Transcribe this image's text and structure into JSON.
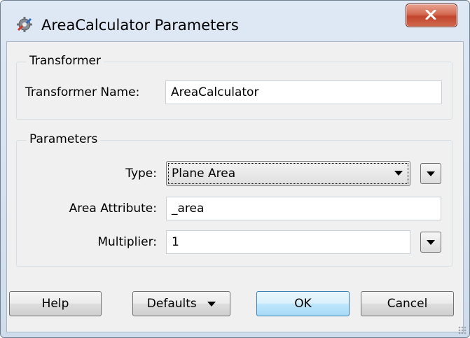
{
  "window": {
    "title": "AreaCalculator Parameters"
  },
  "transformer_group": {
    "title": "Transformer",
    "name_label": "Transformer Name:",
    "name_value": "AreaCalculator"
  },
  "parameters_group": {
    "title": "Parameters",
    "type_label": "Type:",
    "type_value": "Plane Area",
    "area_attribute_label": "Area Attribute:",
    "area_attribute_value": "_area",
    "multiplier_label": "Multiplier:",
    "multiplier_value": "1"
  },
  "buttons": {
    "help": "Help",
    "defaults": "Defaults",
    "ok": "OK",
    "cancel": "Cancel"
  },
  "colors": {
    "close_button": "#c9553c",
    "default_button_border": "#3c7fb1",
    "window_frame": "#cfdcec"
  }
}
